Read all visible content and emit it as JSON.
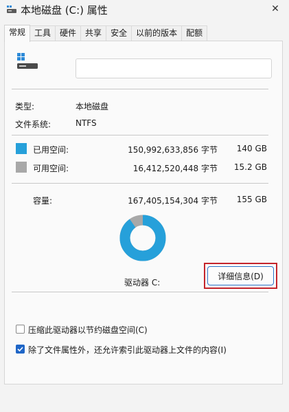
{
  "window": {
    "title": "本地磁盘 (C:) 属性",
    "close_glyph": "✕"
  },
  "tabs": [
    {
      "label": "常规",
      "active": true
    },
    {
      "label": "工具",
      "active": false
    },
    {
      "label": "硬件",
      "active": false
    },
    {
      "label": "共享",
      "active": false
    },
    {
      "label": "安全",
      "active": false
    },
    {
      "label": "以前的版本",
      "active": false
    },
    {
      "label": "配额",
      "active": false
    }
  ],
  "general": {
    "drive_name_value": "",
    "type_label": "类型:",
    "type_value": "本地磁盘",
    "fs_label": "文件系统:",
    "fs_value": "NTFS",
    "used_label": "已用空间:",
    "used_bytes": "150,992,633,856 字节",
    "used_gb": "140 GB",
    "free_label": "可用空间:",
    "free_bytes": "16,412,520,448 字节",
    "free_gb": "15.2 GB",
    "capacity_label": "容量:",
    "capacity_bytes": "167,405,154,304 字节",
    "capacity_gb": "155 GB",
    "drive_label": "驱动器 C:",
    "details_button": "详细信息(D)",
    "compress_label": "压缩此驱动器以节约磁盘空间(C)",
    "compress_checked": false,
    "index_label": "除了文件属性外，还允许索引此驱动器上文件的内容(I)",
    "index_checked": true
  },
  "usage": {
    "used_fraction": 0.902
  },
  "colors": {
    "used": "#26a0da",
    "free": "#a8a8a8",
    "accent": "#1f66c7",
    "highlight": "#c4242b"
  }
}
